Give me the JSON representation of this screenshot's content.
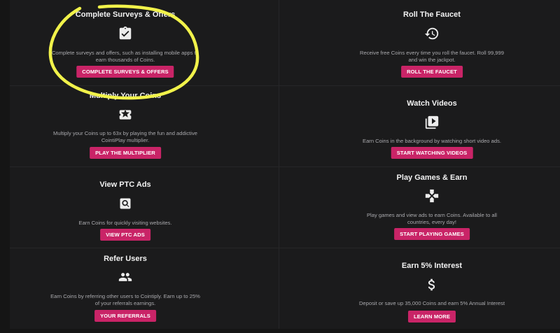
{
  "cards": [
    {
      "title": "Complete Surveys & Offers",
      "icon": "clipboard-check-icon",
      "desc_lines": [
        "Complete surveys and offers, such as installing mobile apps to",
        "earn thousands of Coins."
      ],
      "button": "COMPLETE SURVEYS & OFFERS"
    },
    {
      "title": "Roll The Faucet",
      "icon": "history-icon",
      "desc_lines": [
        "Receive free Coins every time you roll the faucet. Roll 99,999",
        "and win the jackpot."
      ],
      "button": "ROLL THE FAUCET"
    },
    {
      "title": "Multiply Your Coins",
      "icon": "star-ticket-icon",
      "desc_lines": [
        "Multiply your Coins up to 63x by playing the fun and addictive",
        "CointiPlay multiplier."
      ],
      "button": "PLAY THE MULTIPLIER"
    },
    {
      "title": "Watch Videos",
      "icon": "video-library-icon",
      "desc_lines": [
        "Earn Coins in the background by watching short video ads."
      ],
      "button": "START WATCHING VIDEOS"
    },
    {
      "title": "View PTC Ads",
      "icon": "search-box-icon",
      "desc_lines": [
        "Earn Coins for quickly visiting websites."
      ],
      "button": "VIEW PTC ADS"
    },
    {
      "title": "Play Games & Earn",
      "icon": "gamepad-icon",
      "desc_lines": [
        "Play games and view ads to earn Coins. Available to all",
        "countries, every day!"
      ],
      "button": "START PLAYING GAMES"
    },
    {
      "title": "Refer Users",
      "icon": "people-icon",
      "desc_lines": [
        "Earn Coins by referring other users to Cointiply. Earn up to 25%",
        "of your referrals earnings."
      ],
      "button": "YOUR REFERRALS"
    },
    {
      "title": "Earn 5% Interest",
      "icon": "dollar-icon",
      "desc_lines": [
        "Deposit or save up 35,000 Coins and earn 5% Annual Interest"
      ],
      "button": "LEARN MORE"
    }
  ]
}
